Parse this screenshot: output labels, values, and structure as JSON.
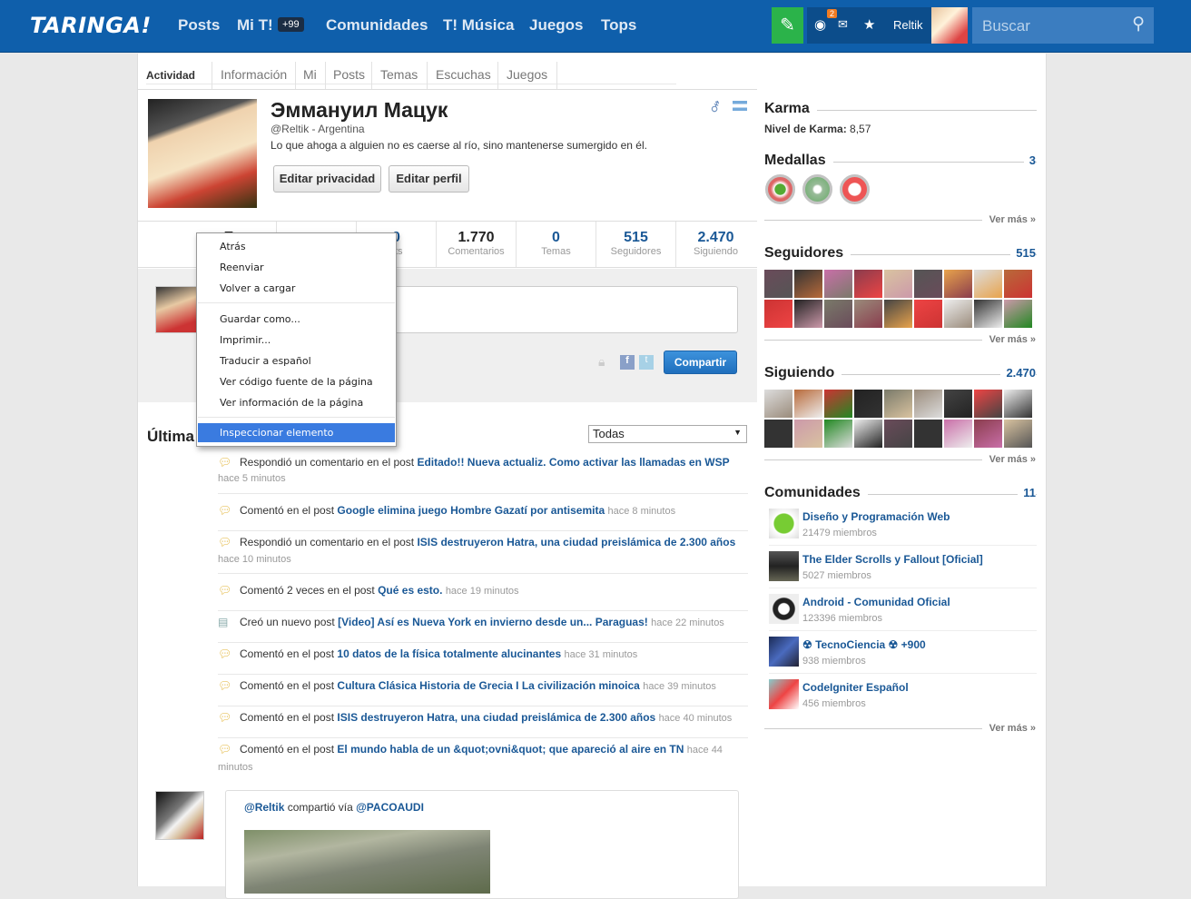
{
  "topbar": {
    "logo": "TARINGA!",
    "nav": [
      "Posts",
      "Mi T!",
      "Comunidades",
      "T! Música",
      "Juegos",
      "Tops"
    ],
    "mit_badge": "+99",
    "notif_count": "2",
    "username": "Reltik",
    "search_placeholder": "Buscar"
  },
  "tabs": [
    "Actividad",
    "Información",
    "Mi",
    "Posts",
    "Temas",
    "Escuchas",
    "Juegos"
  ],
  "profile": {
    "name": "Эммануил Мацук",
    "handle": "@Reltik - Argentina",
    "quote": "Lo que ahoga a alguien no es caerse al río, sino mantenerse sumergido en él.",
    "btn_privacy": "Editar privacidad",
    "btn_edit": "Editar perfil"
  },
  "stats": [
    {
      "value": "E",
      "label": "P"
    },
    {
      "value": "",
      "label": ""
    },
    {
      "value": "0",
      "label": "sts"
    },
    {
      "value": "1.770",
      "label": "Comentarios"
    },
    {
      "value": "0",
      "label": "Temas"
    },
    {
      "value": "515",
      "label": "Seguidores"
    },
    {
      "value": "2.470",
      "label": "Siguiendo"
    }
  ],
  "share_button": "Compartir",
  "feed": {
    "title": "Última",
    "filter": "Todas",
    "items": [
      {
        "pre": "Respondió un comentario en el post ",
        "link": "Editado!! Nueva actualiz. Como activar las llamadas en WSP",
        "time": "hace 5 minutos"
      },
      {
        "pre": "Comentó en el post ",
        "link": "Google elimina juego Hombre Gazatí por antisemita",
        "time": "hace 8 minutos"
      },
      {
        "pre": "Respondió un comentario en el post ",
        "link": "ISIS destruyeron Hatra, una ciudad preislámica de 2.300 años",
        "time": "hace 10 minutos"
      },
      {
        "pre": "Comentó 2 veces en el post ",
        "link": "Qué es esto.",
        "time": "hace 19 minutos"
      },
      {
        "pre": "Creó un nuevo post ",
        "link": "[Video] Así es Nueva York en invierno desde un... Paraguas!",
        "time": "hace 22 minutos"
      },
      {
        "pre": "Comentó en el post ",
        "link": "10 datos de la física totalmente alucinantes",
        "time": "hace 31 minutos"
      },
      {
        "pre": "Comentó en el post ",
        "link": "Cultura Clásica Historia de Grecia I La civilización minoica",
        "time": "hace 39 minutos"
      },
      {
        "pre": "Comentó en el post ",
        "link": "ISIS destruyeron Hatra, una ciudad preislámica de 2.300 años",
        "time": "hace 40 minutos"
      },
      {
        "pre": "Comentó en el post ",
        "link": "El mundo habla de un &quot;ovni&quot; que apareció al aire en TN",
        "time": "hace 44 minutos"
      }
    ],
    "shared": {
      "user": "@Reltik",
      "mid": " compartió vía ",
      "via": "@PACOAUDI"
    }
  },
  "sidebar": {
    "karma_title": "Karma",
    "karma_label": "Nivel de Karma:",
    "karma_value": "8,57",
    "medallas_title": "Medallas",
    "medallas_count": "3",
    "seguidores_title": "Seguidores",
    "seguidores_count": "515",
    "siguiendo_title": "Siguiendo",
    "siguiendo_count": "2.470",
    "comunidades_title": "Comunidades",
    "comunidades_count": "11",
    "ver_mas": "Ver más »",
    "communities": [
      {
        "name": "Diseño y Programación Web",
        "members": "21479 miembros"
      },
      {
        "name": "The Elder Scrolls y Fallout [Oficial]",
        "members": "5027 miembros"
      },
      {
        "name": "Android - Comunidad Oficial",
        "members": "123396 miembros"
      },
      {
        "name": "☢ TecnoCiencia ☢ +900",
        "members": "938 miembros"
      },
      {
        "name": "CodeIgniter Español",
        "members": "456 miembros"
      }
    ]
  },
  "context_menu": {
    "items": [
      "Atrás",
      "Reenviar",
      "Volver a cargar",
      "Guardar como...",
      "Imprimir...",
      "Traducir a español",
      "Ver código fuente de la página",
      "Ver información de la página",
      "Inspeccionar elemento"
    ]
  }
}
